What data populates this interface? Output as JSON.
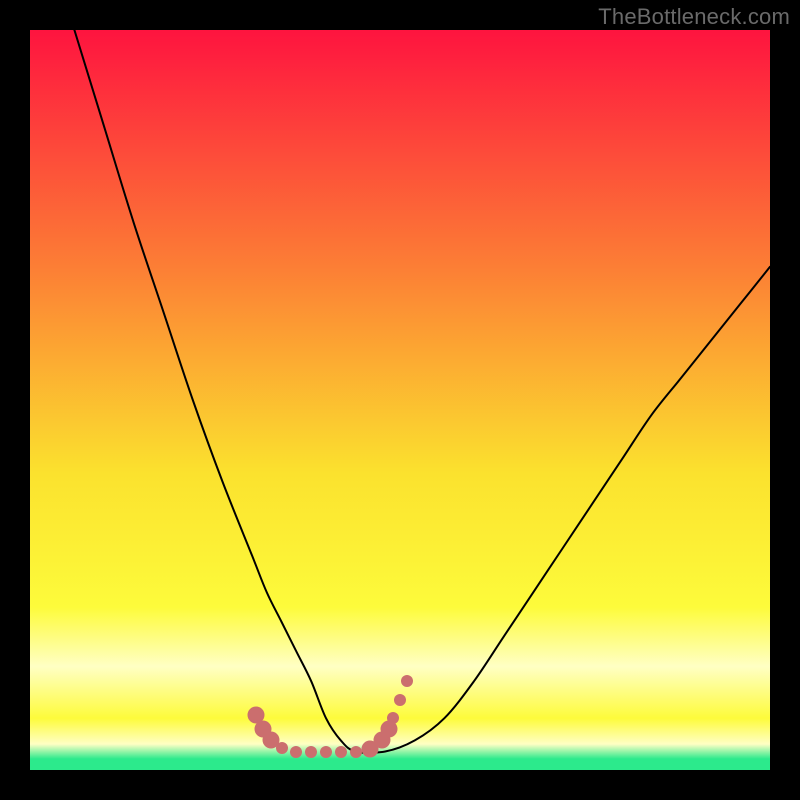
{
  "watermark": "TheBottleneck.com",
  "colors": {
    "gradient_top": "#fe143f",
    "gradient_mid1": "#fc7e35",
    "gradient_mid2": "#fbe22e",
    "gradient_mid3": "#fdfb3b",
    "gradient_band_light": "#ffffc4",
    "gradient_green": "#2cea8c",
    "curve_stroke": "#000000",
    "marker_fill": "#cb6e6e",
    "frame_bg": "#000000"
  },
  "chart_data": {
    "type": "line",
    "title": "",
    "xlabel": "",
    "ylabel": "",
    "xlim": [
      0,
      100
    ],
    "ylim": [
      0,
      100
    ],
    "grid": false,
    "legend": false,
    "series": [
      {
        "name": "bottleneck-curve",
        "x": [
          6,
          10,
          14,
          18,
          22,
          26,
          30,
          32,
          34,
          36,
          38,
          40,
          42,
          44,
          48,
          52,
          56,
          60,
          64,
          68,
          72,
          76,
          80,
          84,
          88,
          92,
          96,
          100
        ],
        "y": [
          100,
          87,
          74,
          62,
          50,
          39,
          29,
          24,
          20,
          16,
          12,
          7,
          4,
          2.5,
          2.5,
          4,
          7,
          12,
          18,
          24,
          30,
          36,
          42,
          48,
          53,
          58,
          63,
          68
        ]
      }
    ],
    "markers": [
      {
        "x": 30.5,
        "y": 7.5,
        "size": "big"
      },
      {
        "x": 31.5,
        "y": 5.5,
        "size": "big"
      },
      {
        "x": 32.5,
        "y": 4.0,
        "size": "big"
      },
      {
        "x": 34.0,
        "y": 3.0,
        "size": "small"
      },
      {
        "x": 36.0,
        "y": 2.5,
        "size": "small"
      },
      {
        "x": 38.0,
        "y": 2.5,
        "size": "small"
      },
      {
        "x": 40.0,
        "y": 2.5,
        "size": "small"
      },
      {
        "x": 42.0,
        "y": 2.5,
        "size": "small"
      },
      {
        "x": 44.0,
        "y": 2.5,
        "size": "small"
      },
      {
        "x": 46.0,
        "y": 2.8,
        "size": "big"
      },
      {
        "x": 47.5,
        "y": 4.0,
        "size": "big"
      },
      {
        "x": 48.5,
        "y": 5.5,
        "size": "big"
      },
      {
        "x": 49.0,
        "y": 7.0,
        "size": "small"
      },
      {
        "x": 50.0,
        "y": 9.5,
        "size": "small"
      },
      {
        "x": 51.0,
        "y": 12.0,
        "size": "small"
      }
    ]
  }
}
